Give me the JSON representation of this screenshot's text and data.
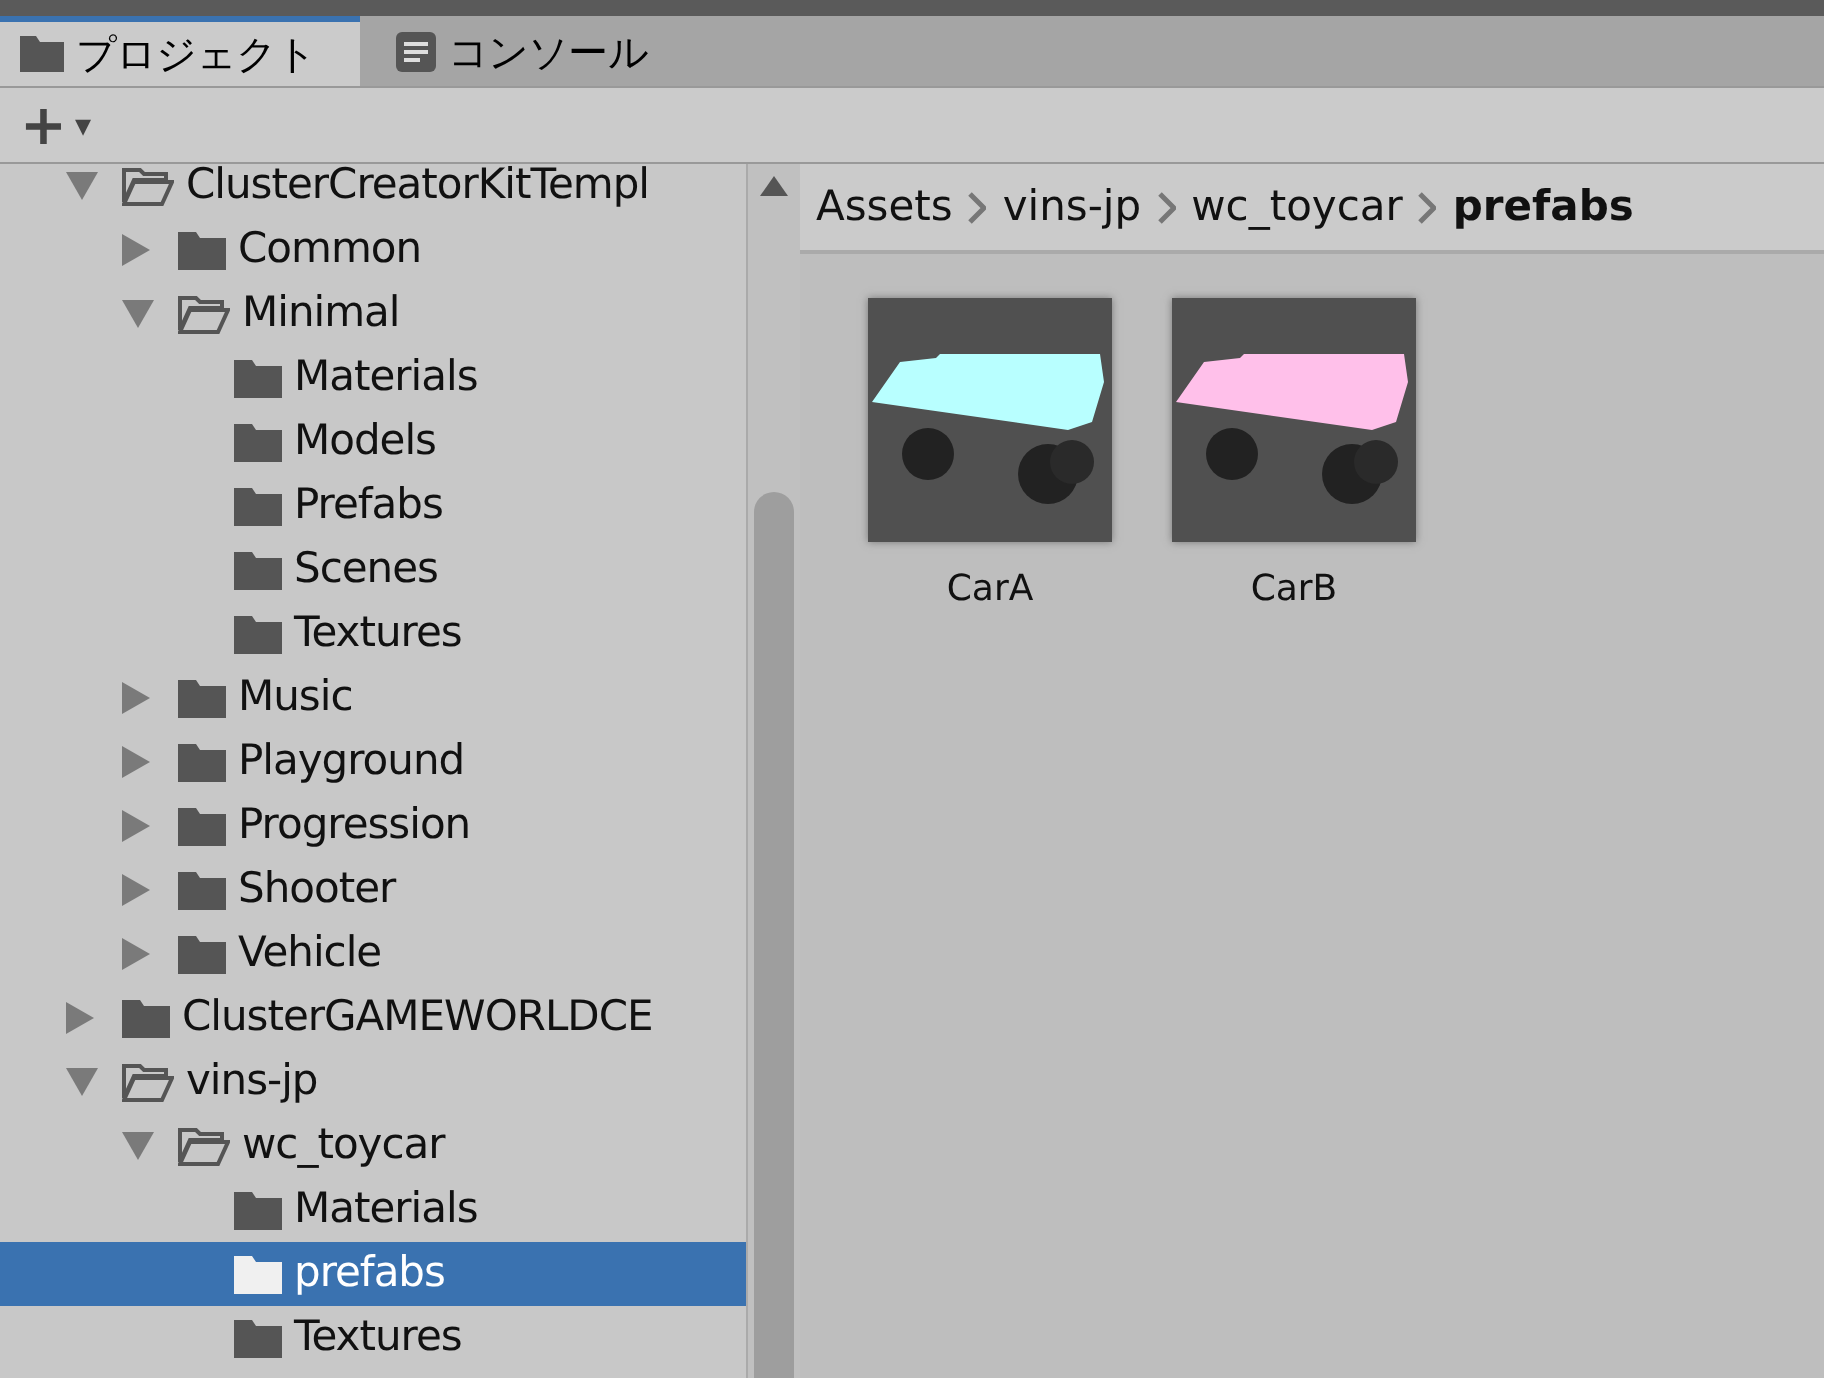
{
  "tabs": [
    {
      "label": "プロジェクト",
      "kind": "folder",
      "selected": true
    },
    {
      "label": "コンソール",
      "kind": "console",
      "selected": false
    }
  ],
  "toolbar": {
    "add": "+",
    "caret": "▾"
  },
  "tree": [
    {
      "label": "ClusterCreatorKitTempl",
      "expanded": true,
      "selected": false,
      "children": [
        {
          "label": "Common",
          "expanded": false,
          "selected": false
        },
        {
          "label": "Minimal",
          "expanded": true,
          "selected": false,
          "children": [
            {
              "label": "Materials",
              "selected": false
            },
            {
              "label": "Models",
              "selected": false
            },
            {
              "label": "Prefabs",
              "selected": false
            },
            {
              "label": "Scenes",
              "selected": false
            },
            {
              "label": "Textures",
              "selected": false
            }
          ]
        },
        {
          "label": "Music",
          "expanded": false,
          "selected": false
        },
        {
          "label": "Playground",
          "expanded": false,
          "selected": false
        },
        {
          "label": "Progression",
          "expanded": false,
          "selected": false
        },
        {
          "label": "Shooter",
          "expanded": false,
          "selected": false
        },
        {
          "label": "Vehicle",
          "expanded": false,
          "selected": false
        }
      ]
    },
    {
      "label": "ClusterGAMEWORLDCE",
      "expanded": false,
      "selected": false
    },
    {
      "label": "vins-jp",
      "expanded": true,
      "selected": false,
      "children": [
        {
          "label": "wc_toycar",
          "expanded": true,
          "selected": false,
          "children": [
            {
              "label": "Materials",
              "selected": false
            },
            {
              "label": "prefabs",
              "selected": true
            },
            {
              "label": "Textures",
              "selected": false
            }
          ]
        }
      ]
    }
  ],
  "breadcrumb": [
    "Assets",
    "vins-jp",
    "wc_toycar",
    "prefabs"
  ],
  "assets": [
    {
      "name": "CarA",
      "color": "#b8ffff"
    },
    {
      "name": "CarB",
      "color": "#ffc0ea"
    }
  ]
}
